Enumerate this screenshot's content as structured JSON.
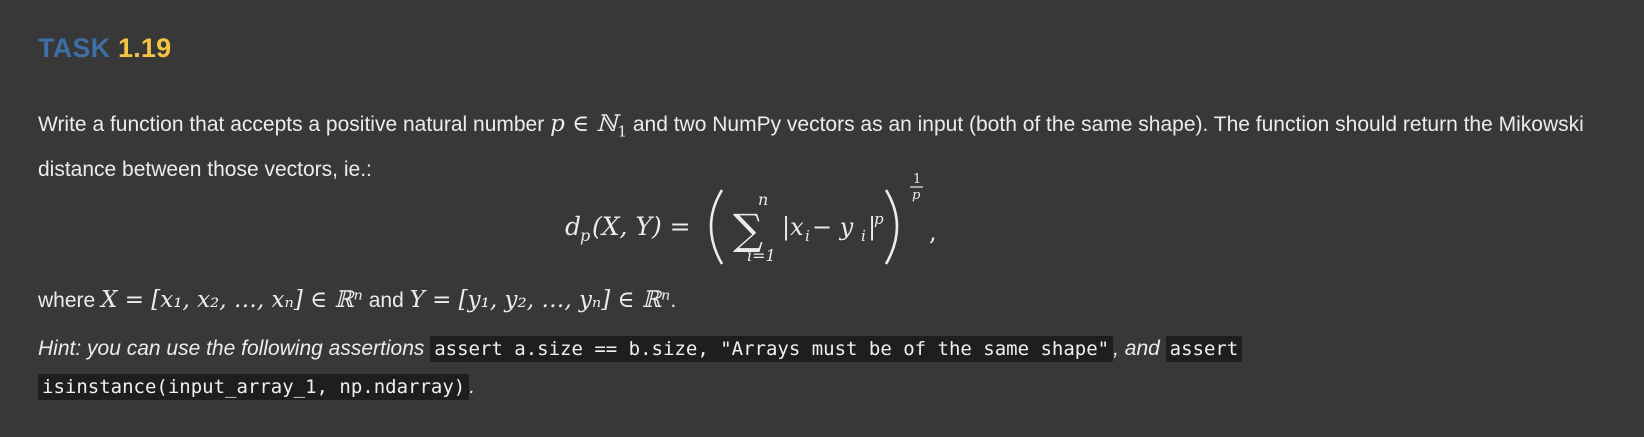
{
  "heading": {
    "word": "TASK",
    "number": "1.19",
    "colors": {
      "word": "#3d6ea5",
      "number": "#f5c542"
    }
  },
  "paragraph": {
    "part1": "Write a function that accepts a positive natural number ",
    "math_p": "p ∈ ℕ",
    "math_p_sub": "1",
    "part2": " and two NumPy vectors as an input (both of the same shape). The function should return the Mikowski distance between those vectors, ie.:"
  },
  "formula": {
    "lhs": "d",
    "lhs_sub": "p",
    "lhs_args": "(X, Y) =",
    "sum_top": "n",
    "sum_bottom": "i=1",
    "sigma": "∑",
    "body": "|x",
    "body_sub1": "i",
    "body_minus": " − y",
    "body_sub2": "i",
    "body_end": "|",
    "body_pow": "p",
    "exp_num": "1",
    "exp_den": "p",
    "trailing": ","
  },
  "where": {
    "w1": "where ",
    "x_math": "X = [x₁, x₂, …, xₙ] ∈ ℝⁿ",
    "and_text": " and ",
    "y_math": "Y = [y₁, y₂, …, yₙ] ∈ ℝⁿ",
    "end": "."
  },
  "hint": {
    "prefix": "Hint: you can use the following assertions ",
    "code1": "assert a.size == b.size, \"Arrays must be of the same shape\"",
    "middle": ", and ",
    "code2a": "assert",
    "code2b": "isinstance(input_array_1, np.ndarray)",
    "end": "."
  }
}
